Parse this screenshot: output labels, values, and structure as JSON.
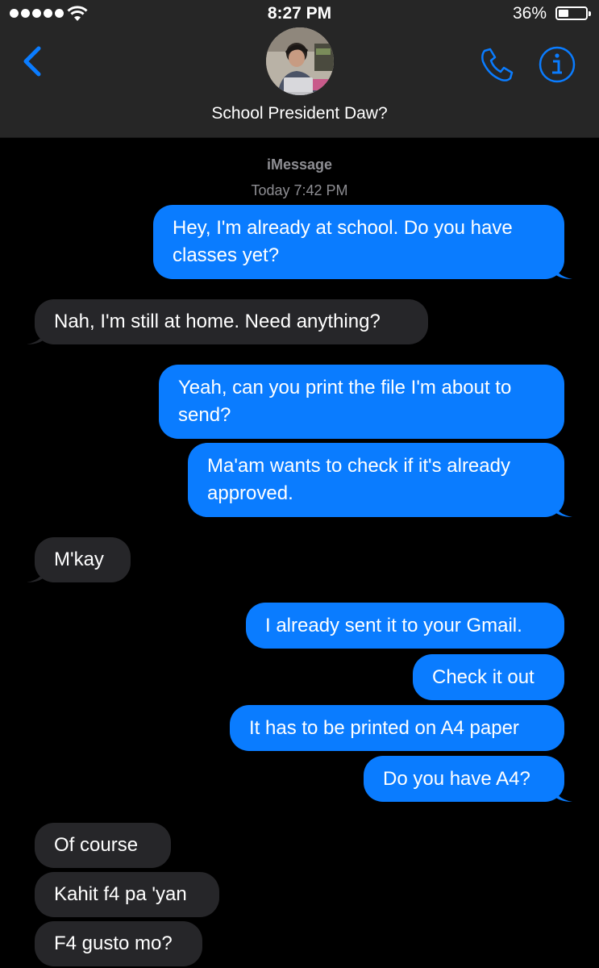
{
  "status_bar": {
    "time": "8:27 PM",
    "battery_percent": "36%",
    "battery_level": 0.36
  },
  "header": {
    "contact_name": "School President Daw?",
    "icons": [
      "chevron-left-icon",
      "phone-icon",
      "info-icon"
    ]
  },
  "thread": {
    "service": "iMessage",
    "timestamp_prefix": "Today",
    "timestamp_time": "7:42 PM",
    "messages": [
      {
        "direction": "sent",
        "text": "Hey, I'm already at school. Do you have classes yet?"
      },
      {
        "direction": "received",
        "text": "Nah, I'm still at home. Need anything?"
      },
      {
        "direction": "sent",
        "text": "Yeah, can you print the file I'm about to send?"
      },
      {
        "direction": "sent",
        "text": "Ma'am wants to check if it's already approved."
      },
      {
        "direction": "received",
        "text": "M'kay"
      },
      {
        "direction": "sent",
        "text": "I already sent it to your Gmail."
      },
      {
        "direction": "sent",
        "text": "Check it out"
      },
      {
        "direction": "sent",
        "text": "It has to be printed on A4 paper"
      },
      {
        "direction": "sent",
        "text": "Do you have A4?"
      },
      {
        "direction": "received",
        "text": "Of course"
      },
      {
        "direction": "received",
        "text": "Kahit f4 pa 'yan"
      },
      {
        "direction": "received",
        "text": "F4 gusto mo?"
      }
    ]
  },
  "colors": {
    "sent_bubble": "#0a7cff",
    "received_bubble": "#262629",
    "accent": "#0a7cff",
    "bar_background": "#262626"
  }
}
